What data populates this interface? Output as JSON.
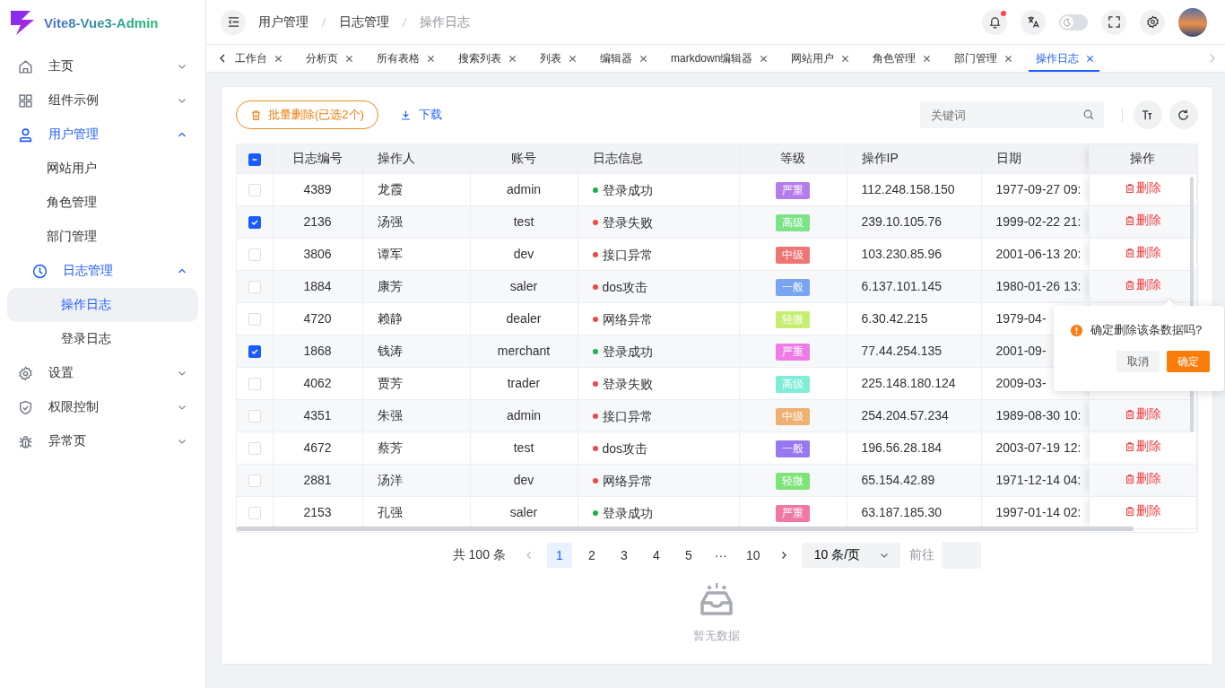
{
  "sidebar": {
    "logo_text": "Vite8-Vue3-Admin",
    "items": [
      {
        "label": "主页",
        "expanded": false,
        "selected": false
      },
      {
        "label": "组件示例",
        "expanded": false,
        "selected": false
      },
      {
        "label": "用户管理",
        "expanded": true,
        "selected": true,
        "children": [
          {
            "label": "网站用户",
            "selected": false
          },
          {
            "label": "角色管理",
            "selected": false
          },
          {
            "label": "部门管理",
            "selected": false
          },
          {
            "label": "日志管理",
            "expanded": true,
            "selected": true,
            "children": [
              {
                "label": "操作日志",
                "selected": true
              },
              {
                "label": "登录日志",
                "selected": false
              }
            ]
          }
        ]
      },
      {
        "label": "设置",
        "expanded": false,
        "selected": false
      },
      {
        "label": "权限控制",
        "expanded": false,
        "selected": false
      },
      {
        "label": "异常页",
        "expanded": false,
        "selected": false
      }
    ]
  },
  "header": {
    "breadcrumb": [
      "用户管理",
      "日志管理",
      "操作日志"
    ],
    "notification_dot": true,
    "theme_toggle": {
      "on": false
    }
  },
  "tabs": [
    {
      "label": "工作台",
      "selected": false
    },
    {
      "label": "分析页",
      "selected": false
    },
    {
      "label": "所有表格",
      "selected": false
    },
    {
      "label": "搜索列表",
      "selected": false
    },
    {
      "label": "列表",
      "selected": false
    },
    {
      "label": "编辑器",
      "selected": false
    },
    {
      "label": "markdown编辑器",
      "selected": false
    },
    {
      "label": "网站用户",
      "selected": false
    },
    {
      "label": "角色管理",
      "selected": false
    },
    {
      "label": "部门管理",
      "selected": false
    },
    {
      "label": "操作日志",
      "selected": true
    }
  ],
  "toolbar": {
    "batch_delete": "批量删除(已选2个)",
    "download": "下载",
    "search": {
      "placeholder": "关键词"
    }
  },
  "table": {
    "select_all": {
      "indeterminate": true
    },
    "columns": [
      "日志编号",
      "操作人",
      "账号",
      "日志信息",
      "等级",
      "操作IP",
      "日期",
      "操作"
    ],
    "rows": [
      {
        "checked": false,
        "id": "4389",
        "operator": "龙霞",
        "account": "admin",
        "info": {
          "text": "登录成功",
          "color": "#19b34a"
        },
        "level": {
          "text": "严重",
          "color": "#b57cec"
        },
        "ip": "112.248.158.150",
        "date": "1977-09-27 09:",
        "action": "删除"
      },
      {
        "checked": true,
        "id": "2136",
        "operator": "汤强",
        "account": "test",
        "info": {
          "text": "登录失败",
          "color": "#f04848"
        },
        "level": {
          "text": "高级",
          "color": "#7ce388"
        },
        "ip": "239.10.105.76",
        "date": "1999-02-22 21:",
        "action": "删除"
      },
      {
        "checked": false,
        "id": "3806",
        "operator": "谭军",
        "account": "dev",
        "info": {
          "text": "接口异常",
          "color": "#f04848"
        },
        "level": {
          "text": "中级",
          "color": "#ef7575"
        },
        "ip": "103.230.85.96",
        "date": "2001-06-13 20:",
        "action": "删除"
      },
      {
        "checked": false,
        "id": "1884",
        "operator": "康芳",
        "account": "saler",
        "info": {
          "text": "dos攻击",
          "color": "#f04848"
        },
        "level": {
          "text": "一般",
          "color": "#78a4f0"
        },
        "ip": "6.137.101.145",
        "date": "1980-01-26 13:",
        "action": "删除"
      },
      {
        "checked": false,
        "id": "4720",
        "operator": "赖静",
        "account": "dealer",
        "info": {
          "text": "网络异常",
          "color": "#f04848"
        },
        "level": {
          "text": "轻微",
          "color": "#c6ee70"
        },
        "ip": "6.30.42.215",
        "date": "1979-04-"
      },
      {
        "checked": true,
        "id": "1868",
        "operator": "钱涛",
        "account": "merchant",
        "info": {
          "text": "登录成功",
          "color": "#19b34a"
        },
        "level": {
          "text": "严重",
          "color": "#ef7ce6"
        },
        "ip": "77.44.254.135",
        "date": "2001-09-"
      },
      {
        "checked": false,
        "id": "4062",
        "operator": "贾芳",
        "account": "trader",
        "info": {
          "text": "登录失败",
          "color": "#f04848"
        },
        "level": {
          "text": "高级",
          "color": "#7eeed6"
        },
        "ip": "225.148.180.124",
        "date": "2009-03-"
      },
      {
        "checked": false,
        "id": "4351",
        "operator": "朱强",
        "account": "admin",
        "info": {
          "text": "接口异常",
          "color": "#f04848"
        },
        "level": {
          "text": "中级",
          "color": "#eeb070"
        },
        "ip": "254.204.57.234",
        "date": "1989-08-30 10:",
        "action": "删除"
      },
      {
        "checked": false,
        "id": "4672",
        "operator": "蔡芳",
        "account": "test",
        "info": {
          "text": "dos攻击",
          "color": "#f04848"
        },
        "level": {
          "text": "一般",
          "color": "#9878ee"
        },
        "ip": "196.56.28.184",
        "date": "2003-07-19 12:",
        "action": "删除"
      },
      {
        "checked": false,
        "id": "2881",
        "operator": "汤洋",
        "account": "dev",
        "info": {
          "text": "网络异常",
          "color": "#f04848"
        },
        "level": {
          "text": "轻微",
          "color": "#7ee47a"
        },
        "ip": "65.154.42.89",
        "date": "1971-12-14 04:",
        "action": "删除"
      },
      {
        "checked": false,
        "id": "2153",
        "operator": "孔强",
        "account": "saler",
        "info": {
          "text": "登录成功",
          "color": "#19b34a"
        },
        "level": {
          "text": "严重",
          "color": "#ef78a4"
        },
        "ip": "63.187.185.30",
        "date": "1997-01-14 02:",
        "action": "删除"
      }
    ]
  },
  "popconfirm": {
    "message": "确定删除该条数据吗?",
    "cancel": "取消",
    "confirm": "确定"
  },
  "pagination": {
    "total": "共 100 条",
    "pages": [
      {
        "label": "1",
        "selected": true
      },
      {
        "label": "2",
        "selected": false
      },
      {
        "label": "3",
        "selected": false
      },
      {
        "label": "4",
        "selected": false
      },
      {
        "label": "5",
        "selected": false
      },
      {
        "label": "···",
        "selected": false
      },
      {
        "label": "10",
        "selected": false
      }
    ],
    "page_size": "10 条/页",
    "goto_label": "前往"
  },
  "empty_state": {
    "text": "暂无数据"
  }
}
